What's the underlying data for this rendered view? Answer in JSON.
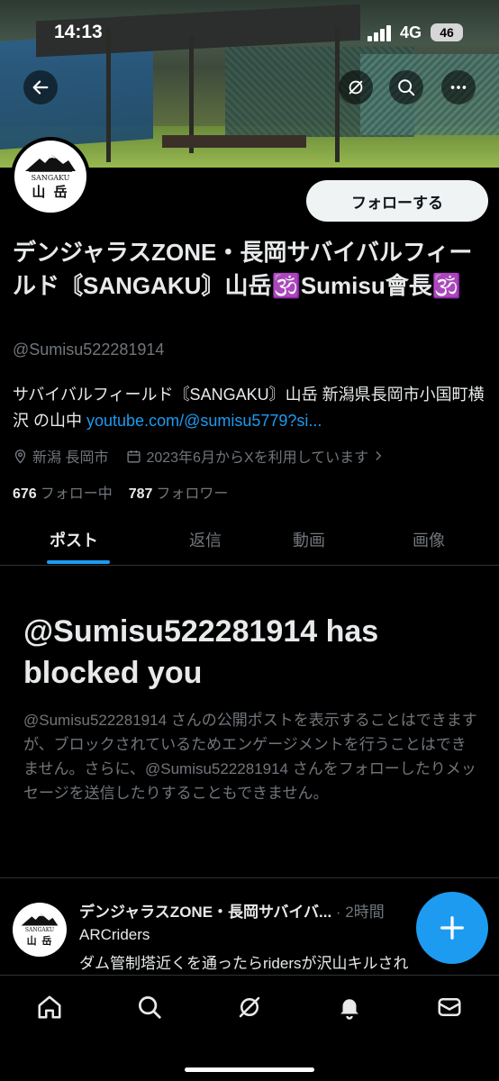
{
  "status_bar": {
    "time": "14:13",
    "network": "4G",
    "battery": "46"
  },
  "profile": {
    "display_name": "デンジャラスZONE・長岡サバイバルフィールド〘SANGAKU〙山岳🕉️Sumisu會長🕉️",
    "handle": "@Sumisu522281914",
    "bio_text": "サバイバルフィールド〘SANGAKU〙山岳 新潟県長岡市小国町横沢 の山中 ",
    "bio_link": "youtube.com/@sumisu5779?si...",
    "location": "新潟 長岡市",
    "joined": "2023年6月からXを利用しています",
    "following_count": "676",
    "following_label": "フォロー中",
    "followers_count": "787",
    "followers_label": "フォロワー",
    "avatar_text_en": "SANGAKU",
    "avatar_text_jp": "山 岳"
  },
  "actions": {
    "follow_label": "フォローする"
  },
  "tabs": [
    {
      "label": "ポスト",
      "active": true
    },
    {
      "label": "返信",
      "active": false
    },
    {
      "label": "動画",
      "active": false
    },
    {
      "label": "画像",
      "active": false
    }
  ],
  "blocked": {
    "title": "@Sumisu522281914 has blocked you",
    "message": "@Sumisu522281914 さんの公開ポストを表示することはできますが、ブロックされているためエンゲージメントを行うことはできません。さらに、@Sumisu522281914 さんをフォローしたりメッセージを送信したりすることもできません。"
  },
  "post_preview": {
    "author": "デンジャラスZONE・長岡サバイバ...",
    "time": " · 2時間",
    "line1": "ARCriders",
    "line2": "ダム管制塔近くを通ったらridersが沢山キルされ"
  },
  "icons": {
    "back": "back-arrow-icon",
    "grok": "grok-icon",
    "search": "search-icon",
    "more": "more-icon",
    "location": "location-pin-icon",
    "calendar": "calendar-icon",
    "compose": "plus-icon",
    "nav_home": "home-icon",
    "nav_search": "search-icon",
    "nav_grok": "grok-icon",
    "nav_notifications": "bell-icon",
    "nav_messages": "mail-icon"
  },
  "colors": {
    "accent": "#1d9bf0",
    "background": "#000000",
    "secondary_text": "#71767b"
  }
}
